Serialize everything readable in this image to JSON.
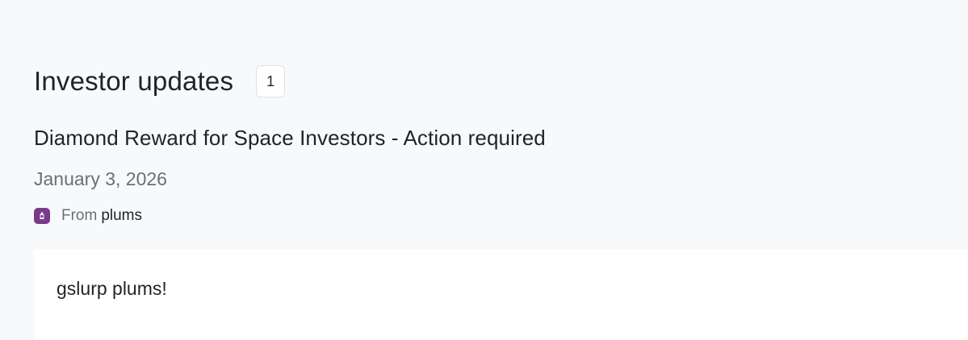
{
  "header": {
    "title": "Investor updates",
    "count": "1"
  },
  "update": {
    "title": "Diamond Reward for Space Investors - Action required",
    "date": "January 3, 2026",
    "from_label": "From",
    "sender": "plums",
    "avatar_icon": "sender-logo-icon",
    "avatar_color": "#7a3a8c",
    "body": "gslurp plums!"
  }
}
